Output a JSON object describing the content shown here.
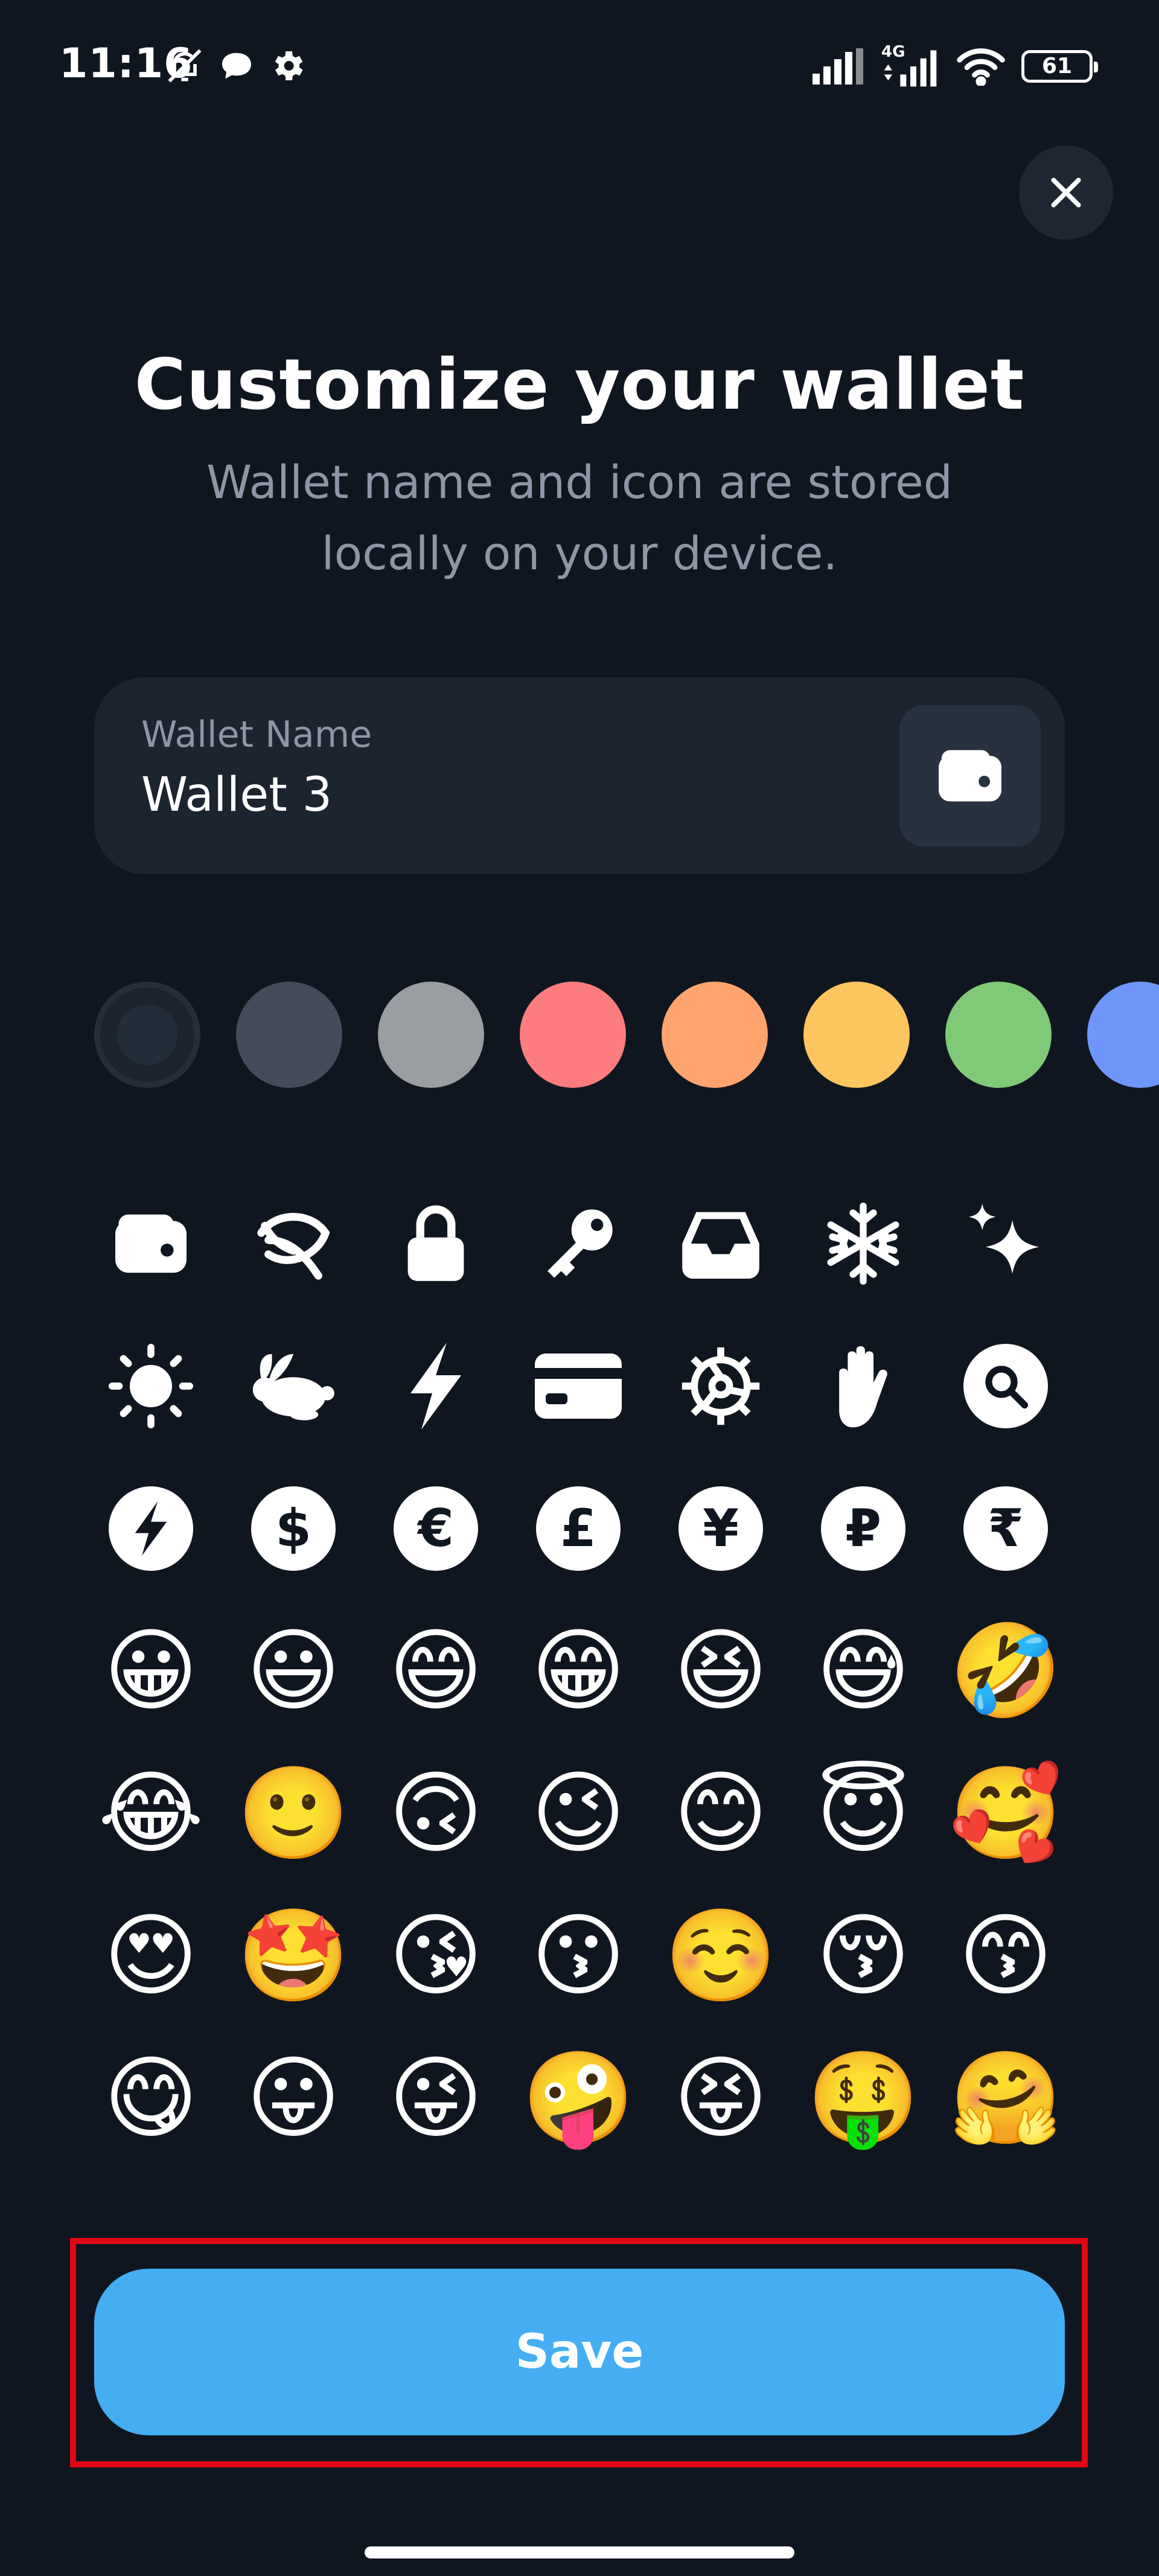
{
  "status_bar": {
    "time": "11:16",
    "network": "4G",
    "battery": "61",
    "icons": [
      "mute-bell-icon",
      "chat-bubble-icon",
      "gear-icon",
      "signal-icon",
      "signal-4g-icon",
      "wifi-icon",
      "battery-icon"
    ]
  },
  "header": {
    "title": "Customize your wallet",
    "subtitle": "Wallet name and icon are stored locally on your device."
  },
  "wallet_name": {
    "label": "Wallet Name",
    "value": "Wallet 3",
    "icon": "wallet-icon"
  },
  "colors": {
    "selected_index": 0,
    "swatches": [
      "#1c2430",
      "#444c5c",
      "#9a9da1",
      "#fd7c7e",
      "#ffa46e",
      "#ffc55e",
      "#80c977",
      "#6e96fb"
    ]
  },
  "icons_row1": [
    "wallet-icon",
    "leaf-icon",
    "lock-icon",
    "key-icon",
    "inbox-icon",
    "snowflake-icon",
    "sparkles-icon"
  ],
  "icons_row2": [
    "sun-icon",
    "rabbit-icon",
    "lightning-icon",
    "credit-card-icon",
    "gear-icon",
    "hand-icon",
    "search-icon"
  ],
  "currency_badges": [
    {
      "name": "lightning-badge-icon",
      "symbol": "⚡"
    },
    {
      "name": "dollar-badge-icon",
      "symbol": "$"
    },
    {
      "name": "euro-badge-icon",
      "symbol": "€"
    },
    {
      "name": "pound-badge-icon",
      "symbol": "£"
    },
    {
      "name": "yen-badge-icon",
      "symbol": "¥"
    },
    {
      "name": "ruble-badge-icon",
      "symbol": "₽"
    },
    {
      "name": "rupee-badge-icon",
      "symbol": "₹"
    }
  ],
  "emoji_rows": [
    [
      "😀",
      "😃",
      "😄",
      "😁",
      "😆",
      "😅",
      "🤣"
    ],
    [
      "😂",
      "🙂",
      "🙃",
      "😉",
      "😊",
      "😇",
      "🥰"
    ],
    [
      "😍",
      "🤩",
      "😘",
      "😗",
      "☺️",
      "😚",
      "😙"
    ],
    [
      "😋",
      "😛",
      "😜",
      "🤪",
      "😝",
      "🤑",
      "🤗"
    ]
  ],
  "save": {
    "label": "Save"
  }
}
